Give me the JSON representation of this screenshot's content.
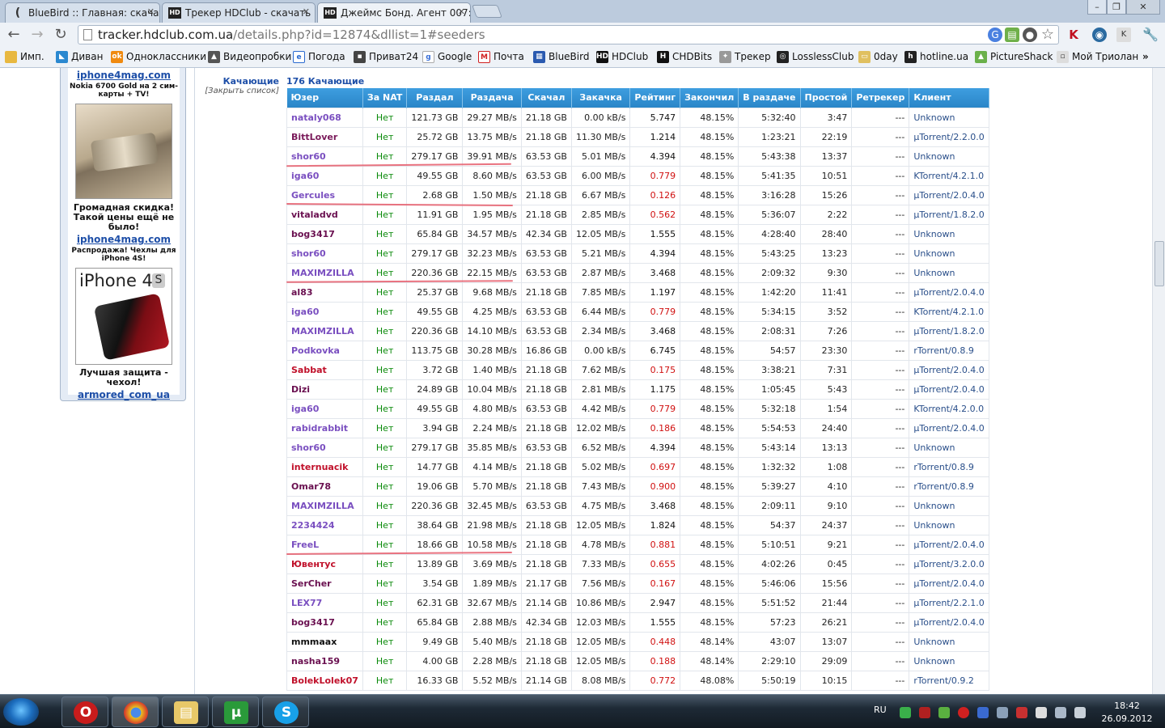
{
  "tabs": [
    {
      "title": "BlueBird :: Главная: скачать",
      "favicon": "bluebird"
    },
    {
      "title": "Трекер HDClub - скачать",
      "favicon": "HD"
    },
    {
      "title": "Джеймс Бонд. Агент 007:",
      "favicon": "HD"
    }
  ],
  "url": {
    "host": "tracker.hdclub.com.ua",
    "path": "/details.php?id=12874&dllist=1#seeders"
  },
  "bookmarks": [
    "Имп.",
    "Диван",
    "Одноклассники",
    "Видеопробки",
    "Погода",
    "Приват24",
    "Google",
    "Почта",
    "BlueBird",
    "HDClub",
    "CHDBits",
    "Трекер",
    "LosslessClub",
    "0day",
    "hotline.ua",
    "PictureShack",
    "Мой Триолан"
  ],
  "sidebar": {
    "link1": "iphone4mag.com",
    "small1": "Nokia 6700 Gold на 2 сим-карты + TV!",
    "promo1": "Громадная скидка! Такой цены ещё не было!",
    "link2": "iphone4mag.com",
    "small2": "Распродажа! Чехлы для iPhone 4S!",
    "iphone_title": "iPhone 4",
    "iphone_s": "S",
    "promo2": "Лучшая защита - чехол!",
    "link3": "armored_com_ua"
  },
  "section": {
    "label": "Качающие",
    "close_list": "[Закрыть список]",
    "count": "176 Качающие"
  },
  "columns": [
    "Юзер",
    "За NAT",
    "Раздал",
    "Раздача",
    "Скачал",
    "Закачка",
    "Рейтинг",
    "Закончил",
    "В раздаче",
    "Простой",
    "Ретрекер",
    "Клиент"
  ],
  "colors": {
    "header_blue": "#2a86c8",
    "nat_green": "#0a8a0a",
    "rating_red": "#d01010",
    "underline": "#e55a6a"
  },
  "rows": [
    {
      "user": "nataly068",
      "uc": "#7a4fc0",
      "nat": "Нет",
      "up": "121.73 GB",
      "upspd": "29.27 MB/s",
      "down": "21.18 GB",
      "dnspd": "0.00 kB/s",
      "ratio": "5.747",
      "rc": "#111",
      "done": "48.15%",
      "seed": "5:32:40",
      "idle": "3:47",
      "re": "---",
      "client": "Unknown"
    },
    {
      "user": "BittLover",
      "uc": "#7a1a5a",
      "nat": "Нет",
      "up": "25.72 GB",
      "upspd": "13.75 MB/s",
      "down": "21.18 GB",
      "dnspd": "11.30 MB/s",
      "ratio": "1.214",
      "rc": "#111",
      "done": "48.15%",
      "seed": "1:23:21",
      "idle": "22:19",
      "re": "---",
      "client": "µTorrent/2.2.0.0"
    },
    {
      "user": "shor60",
      "uc": "#7a4fc0",
      "nat": "Нет",
      "up": "279.17 GB",
      "upspd": "39.91 MB/s",
      "down": "63.53 GB",
      "dnspd": "5.01 MB/s",
      "ratio": "4.394",
      "rc": "#111",
      "done": "48.15%",
      "seed": "5:43:38",
      "idle": "13:37",
      "re": "---",
      "client": "Unknown"
    },
    {
      "user": "iga60",
      "uc": "#7a4fc0",
      "nat": "Нет",
      "up": "49.55 GB",
      "upspd": "8.60 MB/s",
      "down": "63.53 GB",
      "dnspd": "6.00 MB/s",
      "ratio": "0.779",
      "rc": "#d01010",
      "done": "48.15%",
      "seed": "5:41:35",
      "idle": "10:51",
      "re": "---",
      "client": "KTorrent/4.2.1.0"
    },
    {
      "user": "Gercules",
      "uc": "#7a4fc0",
      "nat": "Нет",
      "up": "2.68 GB",
      "upspd": "1.50 MB/s",
      "down": "21.18 GB",
      "dnspd": "6.67 MB/s",
      "ratio": "0.126",
      "rc": "#d01010",
      "done": "48.15%",
      "seed": "3:16:28",
      "idle": "15:26",
      "re": "---",
      "client": "µTorrent/2.0.4.0"
    },
    {
      "user": "vitaladvd",
      "uc": "#6a1050",
      "nat": "Нет",
      "up": "11.91 GB",
      "upspd": "1.95 MB/s",
      "down": "21.18 GB",
      "dnspd": "2.85 MB/s",
      "ratio": "0.562",
      "rc": "#d01010",
      "done": "48.15%",
      "seed": "5:36:07",
      "idle": "2:22",
      "re": "---",
      "client": "µTorrent/1.8.2.0"
    },
    {
      "user": "bog3417",
      "uc": "#6a1050",
      "nat": "Нет",
      "up": "65.84 GB",
      "upspd": "34.57 MB/s",
      "down": "42.34 GB",
      "dnspd": "12.05 MB/s",
      "ratio": "1.555",
      "rc": "#111",
      "done": "48.15%",
      "seed": "4:28:40",
      "idle": "28:40",
      "re": "---",
      "client": "Unknown"
    },
    {
      "user": "shor60",
      "uc": "#7a4fc0",
      "nat": "Нет",
      "up": "279.17 GB",
      "upspd": "32.23 MB/s",
      "down": "63.53 GB",
      "dnspd": "5.21 MB/s",
      "ratio": "4.394",
      "rc": "#111",
      "done": "48.15%",
      "seed": "5:43:25",
      "idle": "13:23",
      "re": "---",
      "client": "Unknown"
    },
    {
      "user": "MAXIMZILLA",
      "uc": "#7a4fc0",
      "nat": "Нет",
      "up": "220.36 GB",
      "upspd": "22.15 MB/s",
      "down": "63.53 GB",
      "dnspd": "2.87 MB/s",
      "ratio": "3.468",
      "rc": "#111",
      "done": "48.15%",
      "seed": "2:09:32",
      "idle": "9:30",
      "re": "---",
      "client": "Unknown"
    },
    {
      "user": "al83",
      "uc": "#6a1050",
      "nat": "Нет",
      "up": "25.37 GB",
      "upspd": "9.68 MB/s",
      "down": "21.18 GB",
      "dnspd": "7.85 MB/s",
      "ratio": "1.197",
      "rc": "#111",
      "done": "48.15%",
      "seed": "1:42:20",
      "idle": "11:41",
      "re": "---",
      "client": "µTorrent/2.0.4.0"
    },
    {
      "user": "iga60",
      "uc": "#7a4fc0",
      "nat": "Нет",
      "up": "49.55 GB",
      "upspd": "4.25 MB/s",
      "down": "63.53 GB",
      "dnspd": "6.44 MB/s",
      "ratio": "0.779",
      "rc": "#d01010",
      "done": "48.15%",
      "seed": "5:34:15",
      "idle": "3:52",
      "re": "---",
      "client": "KTorrent/4.2.1.0"
    },
    {
      "user": "MAXIMZILLA",
      "uc": "#7a4fc0",
      "nat": "Нет",
      "up": "220.36 GB",
      "upspd": "14.10 MB/s",
      "down": "63.53 GB",
      "dnspd": "2.34 MB/s",
      "ratio": "3.468",
      "rc": "#111",
      "done": "48.15%",
      "seed": "2:08:31",
      "idle": "7:26",
      "re": "---",
      "client": "µTorrent/1.8.2.0"
    },
    {
      "user": "Podkovka",
      "uc": "#7a4fc0",
      "nat": "Нет",
      "up": "113.75 GB",
      "upspd": "30.28 MB/s",
      "down": "16.86 GB",
      "dnspd": "0.00 kB/s",
      "ratio": "6.745",
      "rc": "#111",
      "done": "48.15%",
      "seed": "54:57",
      "idle": "23:30",
      "re": "---",
      "client": "rTorrent/0.8.9"
    },
    {
      "user": "Sabbat",
      "uc": "#c0102a",
      "nat": "Нет",
      "up": "3.72 GB",
      "upspd": "1.40 MB/s",
      "down": "21.18 GB",
      "dnspd": "7.62 MB/s",
      "ratio": "0.175",
      "rc": "#d01010",
      "done": "48.15%",
      "seed": "3:38:21",
      "idle": "7:31",
      "re": "---",
      "client": "µTorrent/2.0.4.0"
    },
    {
      "user": "Dizi",
      "uc": "#6a1050",
      "nat": "Нет",
      "up": "24.89 GB",
      "upspd": "10.04 MB/s",
      "down": "21.18 GB",
      "dnspd": "2.81 MB/s",
      "ratio": "1.175",
      "rc": "#111",
      "done": "48.15%",
      "seed": "1:05:45",
      "idle": "5:43",
      "re": "---",
      "client": "µTorrent/2.0.4.0"
    },
    {
      "user": "iga60",
      "uc": "#7a4fc0",
      "nat": "Нет",
      "up": "49.55 GB",
      "upspd": "4.80 MB/s",
      "down": "63.53 GB",
      "dnspd": "4.42 MB/s",
      "ratio": "0.779",
      "rc": "#d01010",
      "done": "48.15%",
      "seed": "5:32:18",
      "idle": "1:54",
      "re": "---",
      "client": "KTorrent/4.2.0.0"
    },
    {
      "user": "rabidrabbit",
      "uc": "#7a4fc0",
      "nat": "Нет",
      "up": "3.94 GB",
      "upspd": "2.24 MB/s",
      "down": "21.18 GB",
      "dnspd": "12.02 MB/s",
      "ratio": "0.186",
      "rc": "#d01010",
      "done": "48.15%",
      "seed": "5:54:53",
      "idle": "24:40",
      "re": "---",
      "client": "µTorrent/2.0.4.0"
    },
    {
      "user": "shor60",
      "uc": "#7a4fc0",
      "nat": "Нет",
      "up": "279.17 GB",
      "upspd": "35.85 MB/s",
      "down": "63.53 GB",
      "dnspd": "6.52 MB/s",
      "ratio": "4.394",
      "rc": "#111",
      "done": "48.15%",
      "seed": "5:43:14",
      "idle": "13:13",
      "re": "---",
      "client": "Unknown"
    },
    {
      "user": "internuacik",
      "uc": "#c0102a",
      "nat": "Нет",
      "up": "14.77 GB",
      "upspd": "4.14 MB/s",
      "down": "21.18 GB",
      "dnspd": "5.02 MB/s",
      "ratio": "0.697",
      "rc": "#d01010",
      "done": "48.15%",
      "seed": "1:32:32",
      "idle": "1:08",
      "re": "---",
      "client": "rTorrent/0.8.9"
    },
    {
      "user": "Omar78",
      "uc": "#6a1050",
      "nat": "Нет",
      "up": "19.06 GB",
      "upspd": "5.70 MB/s",
      "down": "21.18 GB",
      "dnspd": "7.43 MB/s",
      "ratio": "0.900",
      "rc": "#d01010",
      "done": "48.15%",
      "seed": "5:39:27",
      "idle": "4:10",
      "re": "---",
      "client": "rTorrent/0.8.9"
    },
    {
      "user": "MAXIMZILLA",
      "uc": "#7a4fc0",
      "nat": "Нет",
      "up": "220.36 GB",
      "upspd": "32.45 MB/s",
      "down": "63.53 GB",
      "dnspd": "4.75 MB/s",
      "ratio": "3.468",
      "rc": "#111",
      "done": "48.15%",
      "seed": "2:09:11",
      "idle": "9:10",
      "re": "---",
      "client": "Unknown"
    },
    {
      "user": "2234424",
      "uc": "#7a4fc0",
      "nat": "Нет",
      "up": "38.64 GB",
      "upspd": "21.98 MB/s",
      "down": "21.18 GB",
      "dnspd": "12.05 MB/s",
      "ratio": "1.824",
      "rc": "#111",
      "done": "48.15%",
      "seed": "54:37",
      "idle": "24:37",
      "re": "---",
      "client": "Unknown"
    },
    {
      "user": "FreeL",
      "uc": "#7a4fc0",
      "nat": "Нет",
      "up": "18.66 GB",
      "upspd": "10.58 MB/s",
      "down": "21.18 GB",
      "dnspd": "4.78 MB/s",
      "ratio": "0.881",
      "rc": "#d01010",
      "done": "48.15%",
      "seed": "5:10:51",
      "idle": "9:21",
      "re": "---",
      "client": "µTorrent/2.0.4.0"
    },
    {
      "user": "Ювентус",
      "uc": "#c0102a",
      "nat": "Нет",
      "up": "13.89 GB",
      "upspd": "3.69 MB/s",
      "down": "21.18 GB",
      "dnspd": "7.33 MB/s",
      "ratio": "0.655",
      "rc": "#d01010",
      "done": "48.15%",
      "seed": "4:02:26",
      "idle": "0:45",
      "re": "---",
      "client": "µTorrent/3.2.0.0"
    },
    {
      "user": "SerCher",
      "uc": "#6a1050",
      "nat": "Нет",
      "up": "3.54 GB",
      "upspd": "1.89 MB/s",
      "down": "21.17 GB",
      "dnspd": "7.56 MB/s",
      "ratio": "0.167",
      "rc": "#d01010",
      "done": "48.15%",
      "seed": "5:46:06",
      "idle": "15:56",
      "re": "---",
      "client": "µTorrent/2.0.4.0"
    },
    {
      "user": "LEX77",
      "uc": "#7a4fc0",
      "nat": "Нет",
      "up": "62.31 GB",
      "upspd": "32.67 MB/s",
      "down": "21.14 GB",
      "dnspd": "10.86 MB/s",
      "ratio": "2.947",
      "rc": "#111",
      "done": "48.15%",
      "seed": "5:51:52",
      "idle": "21:44",
      "re": "---",
      "client": "µTorrent/2.2.1.0"
    },
    {
      "user": "bog3417",
      "uc": "#6a1050",
      "nat": "Нет",
      "up": "65.84 GB",
      "upspd": "2.88 MB/s",
      "down": "42.34 GB",
      "dnspd": "12.03 MB/s",
      "ratio": "1.555",
      "rc": "#111",
      "done": "48.15%",
      "seed": "57:23",
      "idle": "26:21",
      "re": "---",
      "client": "µTorrent/2.0.4.0"
    },
    {
      "user": "mmmaax",
      "uc": "#111111",
      "nat": "Нет",
      "up": "9.49 GB",
      "upspd": "5.40 MB/s",
      "down": "21.18 GB",
      "dnspd": "12.05 MB/s",
      "ratio": "0.448",
      "rc": "#d01010",
      "done": "48.14%",
      "seed": "43:07",
      "idle": "13:07",
      "re": "---",
      "client": "Unknown"
    },
    {
      "user": "nasha159",
      "uc": "#6a1050",
      "nat": "Нет",
      "up": "4.00 GB",
      "upspd": "2.28 MB/s",
      "down": "21.18 GB",
      "dnspd": "12.05 MB/s",
      "ratio": "0.188",
      "rc": "#d01010",
      "done": "48.14%",
      "seed": "2:29:10",
      "idle": "29:09",
      "re": "---",
      "client": "Unknown"
    },
    {
      "user": "BolekLolek07",
      "uc": "#c0102a",
      "nat": "Нет",
      "up": "16.33 GB",
      "upspd": "5.52 MB/s",
      "down": "21.14 GB",
      "dnspd": "8.08 MB/s",
      "ratio": "0.772",
      "rc": "#d01010",
      "done": "48.08%",
      "seed": "5:50:19",
      "idle": "10:15",
      "re": "---",
      "client": "rTorrent/0.9.2"
    }
  ],
  "taskbar": {
    "lang": "RU",
    "time": "18:42",
    "date": "26.09.2012"
  }
}
